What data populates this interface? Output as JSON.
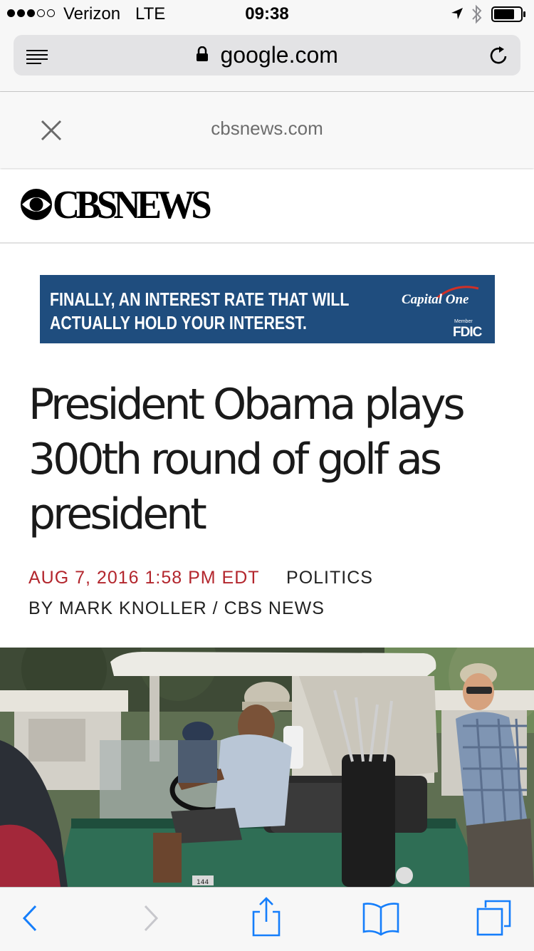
{
  "status_bar": {
    "carrier": "Verizon",
    "network": "LTE",
    "time": "09:38",
    "signal_bars_filled": 3,
    "signal_bars_total": 5,
    "icons": [
      "location-arrow-icon",
      "bluetooth-icon",
      "battery-icon"
    ],
    "battery_level": 0.75
  },
  "url_bar": {
    "url": "google.com",
    "secure": true,
    "icons": [
      "reader-list-icon",
      "lock-icon",
      "reload-icon"
    ]
  },
  "amp_header": {
    "domain": "cbsnews.com",
    "close_icon": "close-icon"
  },
  "site": {
    "brand": "CBSNEWS"
  },
  "ad": {
    "line1": "FINALLY, AN INTEREST RATE THAT WILL",
    "line2": "ACTUALLY HOLD YOUR INTEREST.",
    "advertiser": "Capital One",
    "member_text": "Member",
    "fdic_text": "FDIC",
    "background_color": "#1f4d7e"
  },
  "article": {
    "headline": "President Obama plays 300th round of golf as president",
    "date": "AUG 7, 2016 1:58 PM EDT",
    "category": "POLITICS",
    "byline": "BY MARK KNOLLER / CBS NEWS",
    "date_color": "#b3262d",
    "photo_cart_number": "144"
  },
  "toolbar": {
    "icons": [
      "back-icon",
      "forward-icon",
      "share-icon",
      "bookmarks-icon",
      "tabs-icon"
    ],
    "forward_enabled": false,
    "accent_color": "#157efb"
  }
}
